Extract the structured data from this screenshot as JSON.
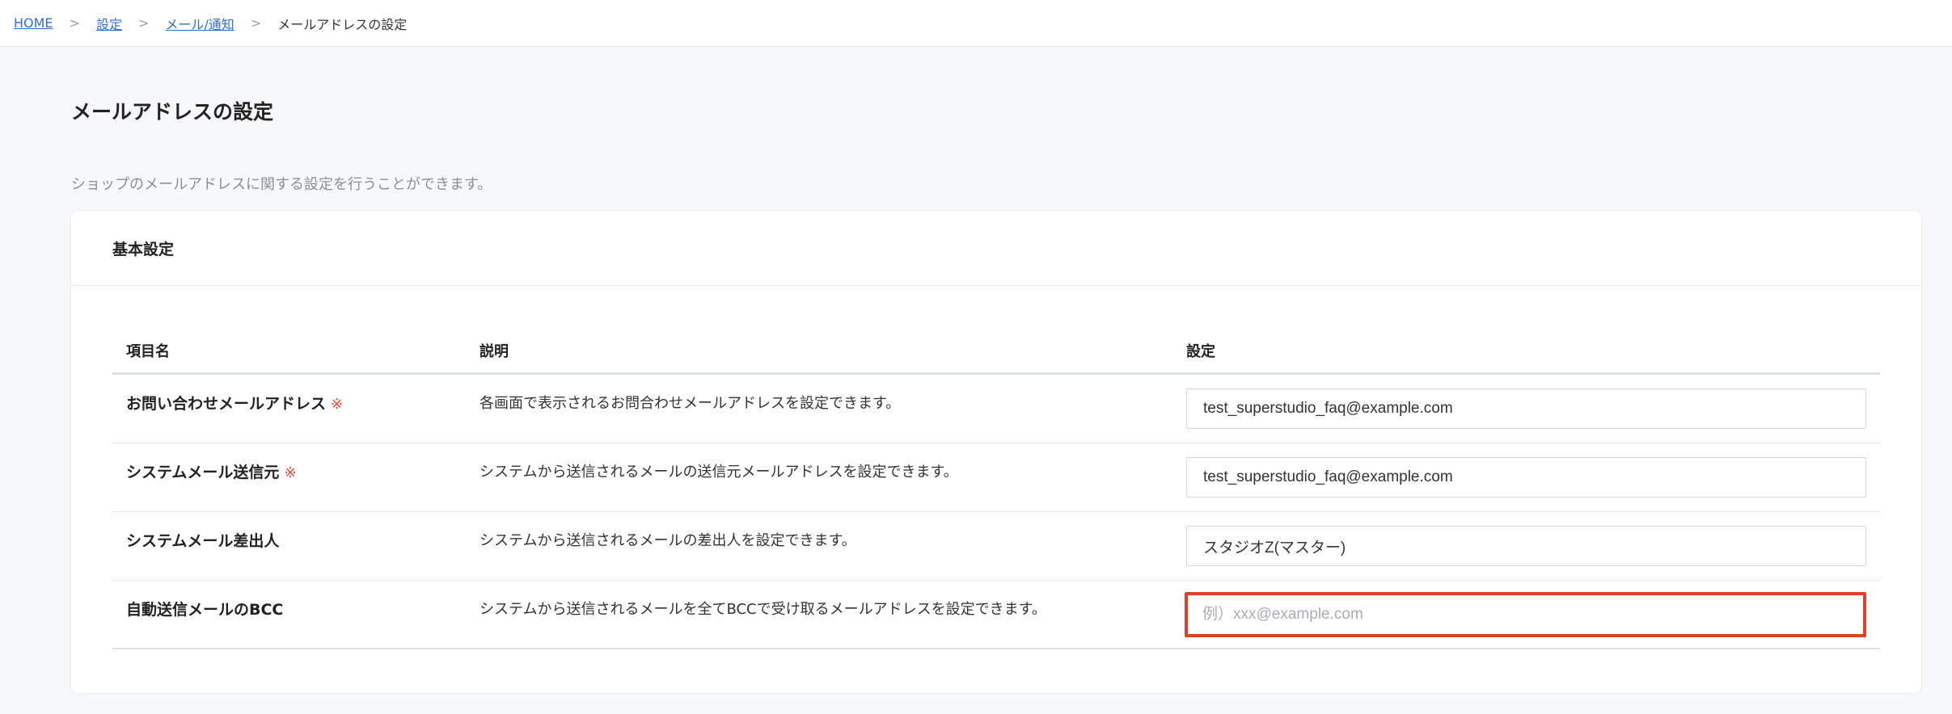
{
  "breadcrumb": {
    "items": [
      "HOME",
      "設定",
      "メール/通知"
    ],
    "separator": ">",
    "current": "メールアドレスの設定"
  },
  "page": {
    "title": "メールアドレスの設定",
    "description": "ショップのメールアドレスに関する設定を行うことができます。"
  },
  "card": {
    "title": "基本設定"
  },
  "table": {
    "headers": [
      "項目名",
      "説明",
      "設定"
    ],
    "required_mark": "※",
    "rows": [
      {
        "name": "お問い合わせメールアドレス",
        "required": true,
        "description": "各画面で表示されるお問合わせメールアドレスを設定できます。",
        "value": "test_superstudio_faq@example.com",
        "placeholder": ""
      },
      {
        "name": "システムメール送信元",
        "required": true,
        "description": "システムから送信されるメールの送信元メールアドレスを設定できます。",
        "value": "test_superstudio_faq@example.com",
        "placeholder": ""
      },
      {
        "name": "システムメール差出人",
        "required": false,
        "description": "システムから送信されるメールの差出人を設定できます。",
        "value": "スタジオZ(マスター)",
        "placeholder": ""
      },
      {
        "name": "自動送信メールのBCC",
        "required": false,
        "description": "システムから送信されるメールを全てBCCで受け取るメールアドレスを設定できます。",
        "value": "",
        "placeholder": "例）xxx@example.com"
      }
    ]
  },
  "colors": {
    "link": "#2f6fd1",
    "required": "#e04a3c",
    "highlight_border": "#e0402a"
  }
}
